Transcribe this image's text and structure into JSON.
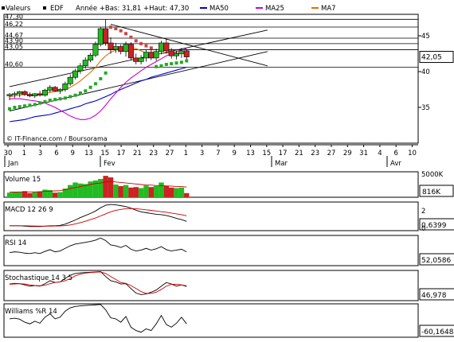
{
  "header": {
    "section": "Valeurs",
    "symbol": "EDF",
    "range_text": "Année +Bas: 31,81 +Haut: 47,30",
    "legend": [
      {
        "name": "MA50",
        "color": "#0000cc"
      },
      {
        "name": "MA25",
        "color": "#cc00cc"
      },
      {
        "name": "MA7",
        "color": "#e07000"
      }
    ]
  },
  "colors": {
    "up": "#22bb22",
    "down": "#cc2222",
    "grid": "#000000",
    "sar": "#22aa22",
    "sar_down": "#cc4444",
    "volume_line": "#cc0000"
  },
  "copyright": "© IT-Finance.com / Boursorama",
  "x_ticks": [
    "30",
    "1",
    "3",
    "6",
    "9",
    "13",
    "15",
    "17",
    "21",
    "23",
    "27",
    "1",
    "3",
    "7",
    "9",
    "13",
    "15",
    "17",
    "21",
    "23",
    "27",
    "29",
    "31",
    "4",
    "6",
    "10"
  ],
  "x_months": [
    "Jan",
    "Fev",
    "Mar",
    "Avr"
  ],
  "chart_data": [
    {
      "type": "candlestick",
      "title": "",
      "ylim": [
        30,
        48
      ],
      "y_ticks": [
        35,
        40,
        45
      ],
      "price_levels": [
        "47,30",
        "46,22",
        "44,67",
        "43,90",
        "43,05",
        "40,60"
      ],
      "last_value": "42,05",
      "candles": [
        {
          "o": 36.6,
          "h": 37.0,
          "l": 36.0,
          "c": 36.8
        },
        {
          "o": 36.8,
          "h": 37.2,
          "l": 36.3,
          "c": 36.9
        },
        {
          "o": 36.9,
          "h": 37.3,
          "l": 36.4,
          "c": 37.2
        },
        {
          "o": 37.2,
          "h": 37.4,
          "l": 36.6,
          "c": 36.8
        },
        {
          "o": 36.8,
          "h": 37.1,
          "l": 36.4,
          "c": 36.6
        },
        {
          "o": 36.6,
          "h": 37.0,
          "l": 36.3,
          "c": 36.9
        },
        {
          "o": 36.9,
          "h": 37.3,
          "l": 36.5,
          "c": 36.7
        },
        {
          "o": 36.7,
          "h": 37.6,
          "l": 36.5,
          "c": 37.4
        },
        {
          "o": 37.4,
          "h": 38.1,
          "l": 37.1,
          "c": 37.8
        },
        {
          "o": 37.8,
          "h": 38.0,
          "l": 37.2,
          "c": 37.3
        },
        {
          "o": 37.3,
          "h": 37.7,
          "l": 36.9,
          "c": 37.5
        },
        {
          "o": 37.5,
          "h": 38.6,
          "l": 37.2,
          "c": 38.3
        },
        {
          "o": 38.3,
          "h": 39.6,
          "l": 38.0,
          "c": 39.2
        },
        {
          "o": 39.2,
          "h": 40.4,
          "l": 38.9,
          "c": 40.1
        },
        {
          "o": 40.1,
          "h": 41.2,
          "l": 39.7,
          "c": 40.8
        },
        {
          "o": 40.8,
          "h": 42.0,
          "l": 40.4,
          "c": 41.6
        },
        {
          "o": 41.6,
          "h": 42.6,
          "l": 41.3,
          "c": 42.3
        },
        {
          "o": 42.3,
          "h": 44.2,
          "l": 42.0,
          "c": 43.8
        },
        {
          "o": 43.8,
          "h": 46.2,
          "l": 43.5,
          "c": 46.0
        },
        {
          "o": 46.0,
          "h": 47.3,
          "l": 43.6,
          "c": 44.0
        },
        {
          "o": 44.0,
          "h": 44.8,
          "l": 42.5,
          "c": 43.1
        },
        {
          "o": 43.1,
          "h": 44.0,
          "l": 42.6,
          "c": 43.5
        },
        {
          "o": 43.5,
          "h": 43.8,
          "l": 42.4,
          "c": 42.8
        },
        {
          "o": 42.8,
          "h": 44.2,
          "l": 42.1,
          "c": 43.8
        },
        {
          "o": 43.8,
          "h": 44.1,
          "l": 41.6,
          "c": 41.9
        },
        {
          "o": 41.9,
          "h": 42.5,
          "l": 41.0,
          "c": 41.4
        },
        {
          "o": 41.4,
          "h": 42.3,
          "l": 41.0,
          "c": 41.9
        },
        {
          "o": 41.9,
          "h": 43.0,
          "l": 41.4,
          "c": 42.7
        },
        {
          "o": 42.7,
          "h": 43.1,
          "l": 41.6,
          "c": 41.9
        },
        {
          "o": 41.9,
          "h": 43.2,
          "l": 41.5,
          "c": 42.8
        },
        {
          "o": 42.8,
          "h": 44.3,
          "l": 42.4,
          "c": 44.0
        },
        {
          "o": 44.0,
          "h": 44.5,
          "l": 42.5,
          "c": 42.9
        },
        {
          "o": 42.9,
          "h": 43.3,
          "l": 41.8,
          "c": 42.2
        },
        {
          "o": 42.2,
          "h": 42.9,
          "l": 41.7,
          "c": 42.5
        },
        {
          "o": 42.5,
          "h": 43.3,
          "l": 41.9,
          "c": 42.9
        },
        {
          "o": 42.9,
          "h": 43.1,
          "l": 41.7,
          "c": 42.05
        }
      ],
      "sar": [
        34.8,
        35.0,
        35.1,
        35.2,
        35.3,
        35.4,
        35.6,
        35.8,
        36.0,
        36.1,
        36.2,
        36.3,
        36.5,
        36.7,
        37.0,
        37.3,
        37.8,
        38.3,
        39.0,
        39.8,
        46.2,
        46.0,
        45.7,
        45.3,
        44.8,
        44.3,
        43.9,
        43.6,
        43.3,
        40.7,
        40.8,
        41.0,
        41.1,
        41.2,
        41.3,
        41.5
      ],
      "ma7": [
        36.5,
        36.6,
        36.7,
        36.8,
        36.8,
        36.8,
        36.8,
        36.9,
        37.1,
        37.2,
        37.3,
        37.5,
        37.8,
        38.2,
        38.7,
        39.3,
        39.9,
        40.6,
        41.5,
        42.2,
        42.7,
        43.0,
        43.3,
        43.5,
        43.4,
        43.2,
        42.9,
        42.6,
        42.4,
        42.4,
        42.5,
        42.6,
        42.6,
        42.6,
        42.6,
        42.5
      ],
      "ma25": [
        36.2,
        36.2,
        36.2,
        36.1,
        36.0,
        35.9,
        35.8,
        35.6,
        35.3,
        35.0,
        34.6,
        34.2,
        33.8,
        33.5,
        33.3,
        33.3,
        33.5,
        33.9,
        34.5,
        35.3,
        36.2,
        37.0,
        37.8,
        38.5,
        39.1,
        39.6,
        40.1,
        40.6,
        41.0,
        41.4,
        41.8,
        42.2,
        42.5,
        42.8,
        43.0,
        43.2
      ],
      "ma50": [
        33.0,
        33.1,
        33.2,
        33.3,
        33.5,
        33.7,
        33.8,
        33.9,
        34.0,
        34.2,
        34.4,
        34.6,
        34.8,
        35.0,
        35.2,
        35.5,
        35.7,
        35.9,
        36.2,
        36.5,
        36.8,
        37.2,
        37.5,
        37.8,
        38.1,
        38.4,
        38.7,
        38.9,
        39.2,
        39.4,
        39.6,
        39.8,
        40.0,
        40.2,
        40.4,
        40.6
      ],
      "trendlines": [
        {
          "x1": 0,
          "y1": 37.9,
          "x2": 51,
          "y2": 45.8
        },
        {
          "x1": 0,
          "y1": 34.5,
          "x2": 51,
          "y2": 42.8
        },
        {
          "x1": 20,
          "y1": 46.6,
          "x2": 51,
          "y2": 40.8
        }
      ],
      "hlines": [
        47.3,
        46.22,
        44.67,
        43.9,
        43.05,
        40.6
      ]
    },
    {
      "type": "bar",
      "title": "Volume 15",
      "last_value": "816K",
      "y_ticks": [
        "5000K"
      ],
      "ylim": [
        0,
        5000
      ],
      "values": [
        900,
        1100,
        1000,
        1200,
        800,
        1000,
        1100,
        1500,
        1400,
        900,
        1000,
        1700,
        2400,
        2900,
        2700,
        2600,
        3100,
        3300,
        3600,
        4200,
        3900,
        2500,
        2200,
        2400,
        1900,
        2000,
        1800,
        2300,
        2000,
        2200,
        2900,
        2300,
        1900,
        1800,
        1900,
        816
      ],
      "directions": [
        "u",
        "u",
        "u",
        "d",
        "d",
        "u",
        "d",
        "u",
        "u",
        "d",
        "u",
        "u",
        "u",
        "u",
        "u",
        "u",
        "u",
        "u",
        "u",
        "d",
        "d",
        "u",
        "d",
        "u",
        "d",
        "d",
        "u",
        "u",
        "d",
        "u",
        "u",
        "d",
        "d",
        "u",
        "u",
        "d"
      ],
      "ma": [
        1000,
        1000,
        1050,
        1050,
        1050,
        1050,
        1100,
        1150,
        1200,
        1250,
        1300,
        1500,
        1700,
        1900,
        2100,
        2300,
        2500,
        2700,
        2800,
        3000,
        3100,
        3000,
        2900,
        2800,
        2700,
        2600,
        2500,
        2400,
        2400,
        2300,
        2300,
        2200,
        2200,
        2100,
        2100,
        2000
      ]
    },
    {
      "type": "line",
      "title": "MACD 12 26 9",
      "last_value": "0,6399",
      "y_ticks": [
        "2",
        "0"
      ],
      "ylim": [
        -0.5,
        3
      ],
      "series": [
        {
          "name": "",
          "color": "#000000",
          "values": [
            0.1,
            0.1,
            0.1,
            0.05,
            0.0,
            0.0,
            0.0,
            0.05,
            0.1,
            0.1,
            0.15,
            0.3,
            0.55,
            0.8,
            1.1,
            1.35,
            1.6,
            1.9,
            2.3,
            2.6,
            2.7,
            2.65,
            2.55,
            2.45,
            2.25,
            2.0,
            1.8,
            1.7,
            1.6,
            1.5,
            1.45,
            1.35,
            1.2,
            1.0,
            0.85,
            0.64
          ]
        },
        {
          "name": "",
          "color": "#cc0000",
          "values": [
            0.1,
            0.1,
            0.1,
            0.1,
            0.08,
            0.06,
            0.05,
            0.05,
            0.06,
            0.07,
            0.08,
            0.12,
            0.2,
            0.32,
            0.48,
            0.65,
            0.85,
            1.05,
            1.3,
            1.55,
            1.8,
            1.98,
            2.1,
            2.18,
            2.2,
            2.18,
            2.12,
            2.05,
            1.98,
            1.9,
            1.82,
            1.75,
            1.65,
            1.55,
            1.45,
            1.32
          ]
        }
      ]
    },
    {
      "type": "line",
      "title": "RSI 14",
      "last_value": "52,0586",
      "ylim": [
        20,
        90
      ],
      "series": [
        {
          "name": "",
          "color": "#000000",
          "values": [
            50,
            52,
            51,
            49,
            48,
            50,
            48,
            53,
            57,
            52,
            54,
            60,
            66,
            70,
            72,
            74,
            76,
            79,
            84,
            78,
            68,
            66,
            62,
            67,
            58,
            54,
            56,
            60,
            56,
            59,
            64,
            57,
            54,
            56,
            58,
            52
          ]
        }
      ]
    },
    {
      "type": "line",
      "title": "Stochastique 14 3 5",
      "last_value": "46,978",
      "ylim": [
        0,
        100
      ],
      "series": [
        {
          "name": "",
          "color": "#000000",
          "values": [
            55,
            57,
            56,
            52,
            48,
            50,
            48,
            56,
            66,
            60,
            62,
            74,
            84,
            90,
            92,
            93,
            94,
            95,
            96,
            80,
            66,
            62,
            55,
            56,
            40,
            25,
            20,
            22,
            28,
            35,
            48,
            60,
            55,
            48,
            52,
            47
          ]
        },
        {
          "name": "",
          "color": "#cc0000",
          "values": [
            54,
            55,
            56,
            55,
            52,
            50,
            49,
            51,
            56,
            60,
            62,
            66,
            73,
            82,
            88,
            91,
            93,
            94,
            95,
            90,
            80,
            70,
            60,
            57,
            50,
            40,
            30,
            24,
            24,
            28,
            37,
            48,
            54,
            54,
            52,
            49
          ]
        }
      ]
    },
    {
      "type": "line",
      "title": "Williams %R 14",
      "last_value": "-60,1648",
      "ylim": [
        -100,
        0
      ],
      "series": [
        {
          "name": "",
          "color": "#000000",
          "values": [
            -45,
            -43,
            -46,
            -55,
            -60,
            -52,
            -58,
            -40,
            -30,
            -45,
            -40,
            -22,
            -12,
            -8,
            -6,
            -5,
            -4,
            -3,
            -2,
            -18,
            -42,
            -45,
            -55,
            -38,
            -70,
            -80,
            -85,
            -75,
            -80,
            -60,
            -35,
            -62,
            -70,
            -58,
            -40,
            -60
          ]
        }
      ]
    }
  ]
}
